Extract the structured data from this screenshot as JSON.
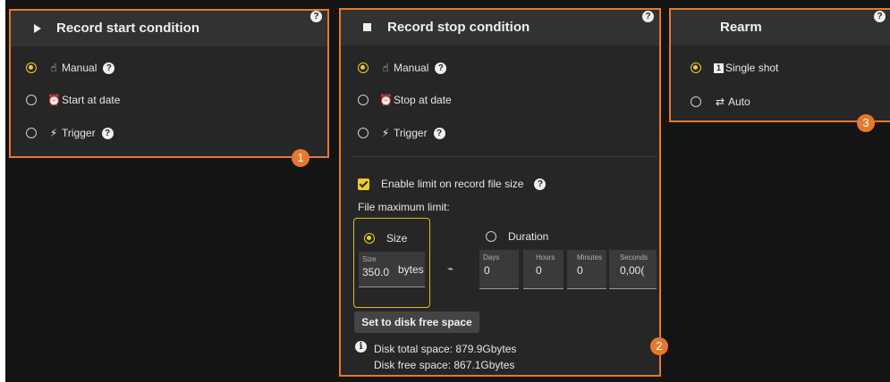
{
  "panel1": {
    "title": "Record start condition",
    "help": "?",
    "options": [
      {
        "label": "Manual",
        "icon": "hand-pointer-icon",
        "selected": true,
        "has_help": true
      },
      {
        "label": "Start at date",
        "icon": "alarm-clock-icon",
        "selected": false,
        "has_help": false
      },
      {
        "label": "Trigger",
        "icon": "lightning-icon",
        "selected": false,
        "has_help": true
      }
    ],
    "badge": "1"
  },
  "panel2": {
    "title": "Record stop condition",
    "help": "?",
    "options": [
      {
        "label": "Manual",
        "icon": "hand-pointer-icon",
        "selected": true,
        "has_help": true
      },
      {
        "label": "Stop at date",
        "icon": "alarm-clock-icon",
        "selected": false,
        "has_help": false
      },
      {
        "label": "Trigger",
        "icon": "lightning-icon",
        "selected": false,
        "has_help": true
      }
    ],
    "limit_checkbox_label": "Enable limit on record file size",
    "limit_checked": true,
    "file_max_label": "File maximum limit:",
    "size_option": {
      "label": "Size",
      "selected": true
    },
    "size_field": {
      "label": "Size",
      "value": "350.0",
      "unit": "bytes"
    },
    "duration_option": {
      "label": "Duration",
      "selected": false
    },
    "duration_fields": [
      {
        "label": "Days",
        "value": "0"
      },
      {
        "label": "Hours",
        "value": "0"
      },
      {
        "label": "Minutes",
        "value": "0"
      },
      {
        "label": "Seconds",
        "value": "0,00("
      }
    ],
    "set_disk_button": "Set to disk free space",
    "disk_total": "Disk total space:  879.9Gbytes",
    "disk_free": "Disk free space:  867.1Gbytes",
    "badge": "2"
  },
  "panel3": {
    "title": "Rearm",
    "help": "?",
    "options": [
      {
        "label": "Single shot",
        "icon": "single-shot-icon",
        "selected": true
      },
      {
        "label": "Auto",
        "icon": "repeat-icon",
        "selected": false
      }
    ],
    "badge": "3"
  },
  "colors": {
    "accent_border": "#e8772e",
    "radio_selected": "#f2cd1b",
    "panel_bg": "#262626",
    "header_bg": "#323232"
  }
}
